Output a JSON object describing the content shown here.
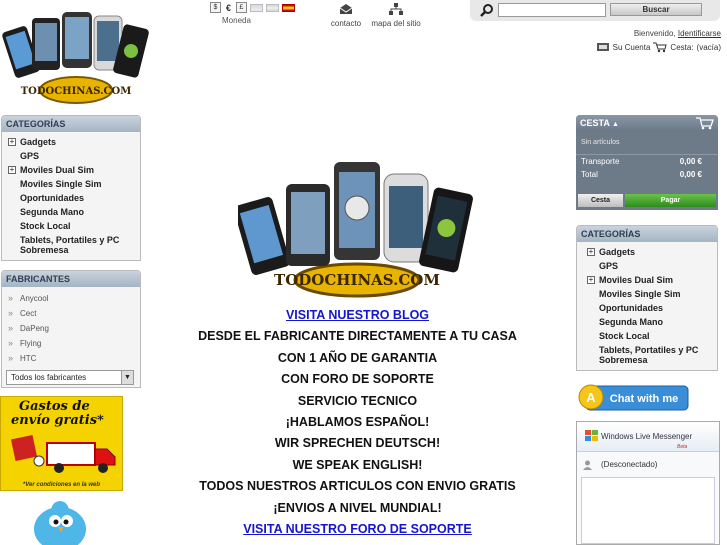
{
  "header": {
    "currency_symbols": [
      "$",
      "€",
      "£"
    ],
    "currency_label": "Moneda",
    "contact_label": "contacto",
    "sitemap_label": "mapa del sitio",
    "search": {
      "placeholder": "",
      "button_label": "Buscar"
    },
    "welcome_text": "Bienvenido,",
    "login_link": "Identificarse",
    "account_label": "Su Cuenta",
    "cart_label": "Cesta:",
    "cart_status": "(vacía)",
    "logo_text": "TODOCHINAS.COM"
  },
  "left_categories": {
    "title": "CATEGORÍAS",
    "items": [
      {
        "label": "Gadgets",
        "expandable": true
      },
      {
        "label": "GPS",
        "expandable": false
      },
      {
        "label": "Moviles Dual Sim",
        "expandable": true
      },
      {
        "label": "Moviles Single Sim",
        "expandable": false
      },
      {
        "label": "Oportunidades",
        "expandable": false
      },
      {
        "label": "Segunda Mano",
        "expandable": false
      },
      {
        "label": "Stock Local",
        "expandable": false
      },
      {
        "label": "Tablets, Portatiles y PC Sobremesa",
        "expandable": false
      }
    ]
  },
  "manufacturers": {
    "title": "FABRICANTES",
    "items": [
      "Anycool",
      "Cect",
      "DaPeng",
      "Flying",
      "HTC"
    ],
    "select_value": "Todos los fabricantes"
  },
  "shipping_banner": {
    "line1": "Gastos de",
    "line2": "envío gratis*",
    "footnote": "*Ver condiciones en la web"
  },
  "cart": {
    "title": "CESTA",
    "empty_text": "Sin artículos",
    "rows": [
      {
        "label": "Transporte",
        "value": "0,00 €"
      },
      {
        "label": "Total",
        "value": "0,00 €"
      }
    ],
    "cart_button": "Cesta",
    "pay_button": "Pagar"
  },
  "right_categories": {
    "title": "CATEGORÍAS",
    "items": [
      {
        "label": "Gadgets",
        "expandable": true
      },
      {
        "label": "GPS",
        "expandable": false
      },
      {
        "label": "Moviles Dual Sim",
        "expandable": true
      },
      {
        "label": "Moviles Single Sim",
        "expandable": false
      },
      {
        "label": "Oportunidades",
        "expandable": false
      },
      {
        "label": "Segunda Mano",
        "expandable": false
      },
      {
        "label": "Stock Local",
        "expandable": false
      },
      {
        "label": "Tablets, Portatiles y PC Sobremesa",
        "expandable": false
      }
    ]
  },
  "chat": {
    "label": "Chat with me"
  },
  "messenger": {
    "title": "Windows Live Messenger",
    "beta": "Beta",
    "status": "(Desconectado)"
  },
  "main": {
    "hero_logo_text": "TODOCHINAS.COM",
    "lines": [
      {
        "text": "VISITA NUESTRO BLOG",
        "link": true
      },
      {
        "text": "DESDE EL FABRICANTE DIRECTAMENTE A TU CASA",
        "link": false
      },
      {
        "text": "CON 1 AÑO DE GARANTIA",
        "link": false
      },
      {
        "text": "CON FORO DE SOPORTE",
        "link": false
      },
      {
        "text": "SERVICIO TECNICO",
        "link": false
      },
      {
        "text": "¡HABLAMOS ESPAÑOL!",
        "link": false
      },
      {
        "text": "WIR SPRECHEN DEUTSCH!",
        "link": false
      },
      {
        "text": "WE SPEAK ENGLISH!",
        "link": false
      },
      {
        "text": "TODOS NUESTROS ARTICULOS CON ENVIO GRATIS",
        "link": false
      },
      {
        "text": "¡ENVIOS A NIVEL MUNDIAL!",
        "link": false
      },
      {
        "text": "VISITA NUESTRO FORO DE SOPORTE",
        "link": true
      }
    ]
  },
  "colors": {
    "panel_head": "#a5b4c3",
    "cart_bg": "#6d7a87",
    "pay_green": "#2e8c1e",
    "banner_yellow": "#f5d300",
    "link_blue": "#1515d0"
  }
}
